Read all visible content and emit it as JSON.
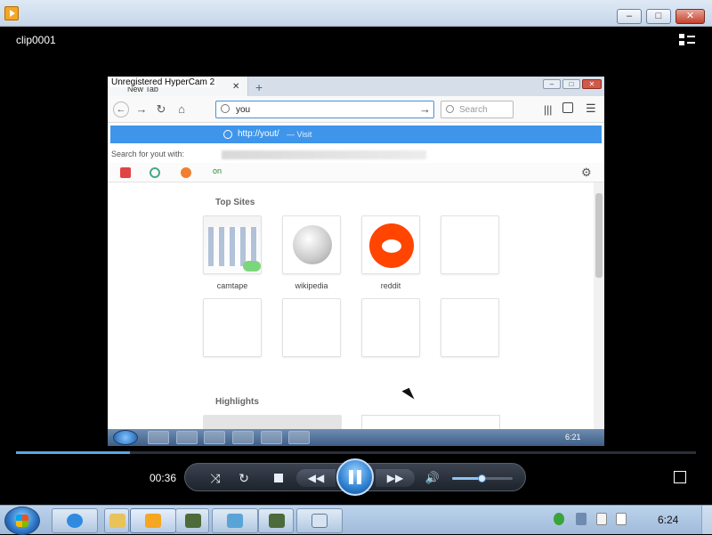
{
  "window": {
    "minimize": "–",
    "maximize": "□",
    "close": "✕"
  },
  "player": {
    "clip_title": "clip0001",
    "elapsed": "00:36",
    "progress": 0.167,
    "volume": 0.5,
    "icons": [
      "switch-view-icon",
      "shuffle-icon",
      "repeat-icon",
      "stop-icon",
      "previous-icon",
      "pause-icon",
      "next-icon",
      "volume-icon",
      "fullscreen-icon"
    ]
  },
  "video": {
    "watermark": "Unregistered HyperCam 2",
    "browser": {
      "tab_title": "New Tab",
      "tab_close": "✕",
      "new_tab": "+",
      "window": {
        "minimize": "–",
        "maximize": "□",
        "close": "✕"
      },
      "url_value": "you",
      "search_placeholder": "Search",
      "suggestion_url": "http://yout/",
      "suggestion_action": "— Visit",
      "search_with": "Search for yout with:",
      "bookmark_label": "on",
      "top_sites_heading": "Top Sites",
      "top_sites": [
        {
          "label": "camtape"
        },
        {
          "label": "wikipedia"
        },
        {
          "label": "reddit"
        }
      ],
      "highlights_heading": "Highlights"
    },
    "inner_clock": "6:21"
  },
  "taskbar": {
    "clock": "6:24",
    "items": [
      "internet-explorer",
      "windows-explorer",
      "windows-media-player",
      "app-4",
      "app-5",
      "app-6",
      "app-7"
    ]
  },
  "colors": {
    "reddit": "#ff4500",
    "suggestion_bar": "#3f95ea",
    "accent": "#59a5e6"
  }
}
